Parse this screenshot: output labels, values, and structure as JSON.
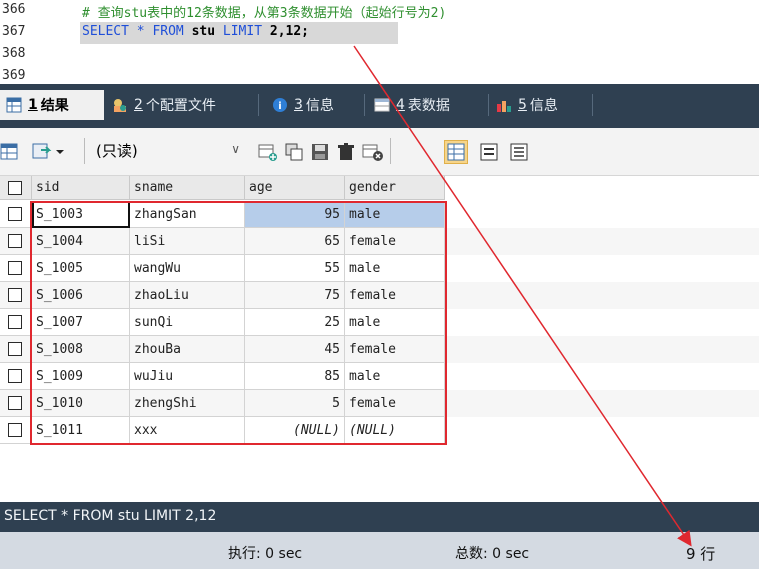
{
  "editor": {
    "lines": [
      {
        "num": "366",
        "comment": "# 查询stu表中的12条数据，从第3条数据开始（起始行号为2)"
      },
      {
        "num": "367",
        "sql_keyword1": "SELECT",
        "sql_star": "*",
        "sql_keyword2": "FROM",
        "sql_table": "stu",
        "sql_keyword3": "LIMIT",
        "sql_args": "2,12;"
      },
      {
        "num": "368"
      },
      {
        "num": "369"
      }
    ]
  },
  "tabs": [
    {
      "num": "1",
      "label": "结果"
    },
    {
      "num": "2",
      "label": "个配置文件"
    },
    {
      "num": "3",
      "label": "信息"
    },
    {
      "num": "4",
      "label": "表数据"
    },
    {
      "num": "5",
      "label": "信息"
    }
  ],
  "toolbar": {
    "mode": "(只读)",
    "mode_caret": "∨"
  },
  "grid": {
    "columns": [
      "sid",
      "sname",
      "age",
      "gender"
    ],
    "rows": [
      [
        "S_1003",
        "zhangSan",
        "95",
        "male"
      ],
      [
        "S_1004",
        "liSi",
        "65",
        "female"
      ],
      [
        "S_1005",
        "wangWu",
        "55",
        "male"
      ],
      [
        "S_1006",
        "zhaoLiu",
        "75",
        "female"
      ],
      [
        "S_1007",
        "sunQi",
        "25",
        "male"
      ],
      [
        "S_1008",
        "zhouBa",
        "45",
        "female"
      ],
      [
        "S_1009",
        "wuJiu",
        "85",
        "male"
      ],
      [
        "S_1010",
        "zhengShi",
        "5",
        "female"
      ],
      [
        "S_1011",
        "xxx",
        "(NULL)",
        "(NULL)"
      ]
    ]
  },
  "sqlbar": {
    "text": "SELECT * FROM stu LIMIT 2,12"
  },
  "status": {
    "exec": "执行: 0 sec",
    "total": "总数: 0 sec",
    "rows": "9 行"
  },
  "colors": {
    "highlight": "#e0282f",
    "dark_bar": "#2f4051"
  }
}
